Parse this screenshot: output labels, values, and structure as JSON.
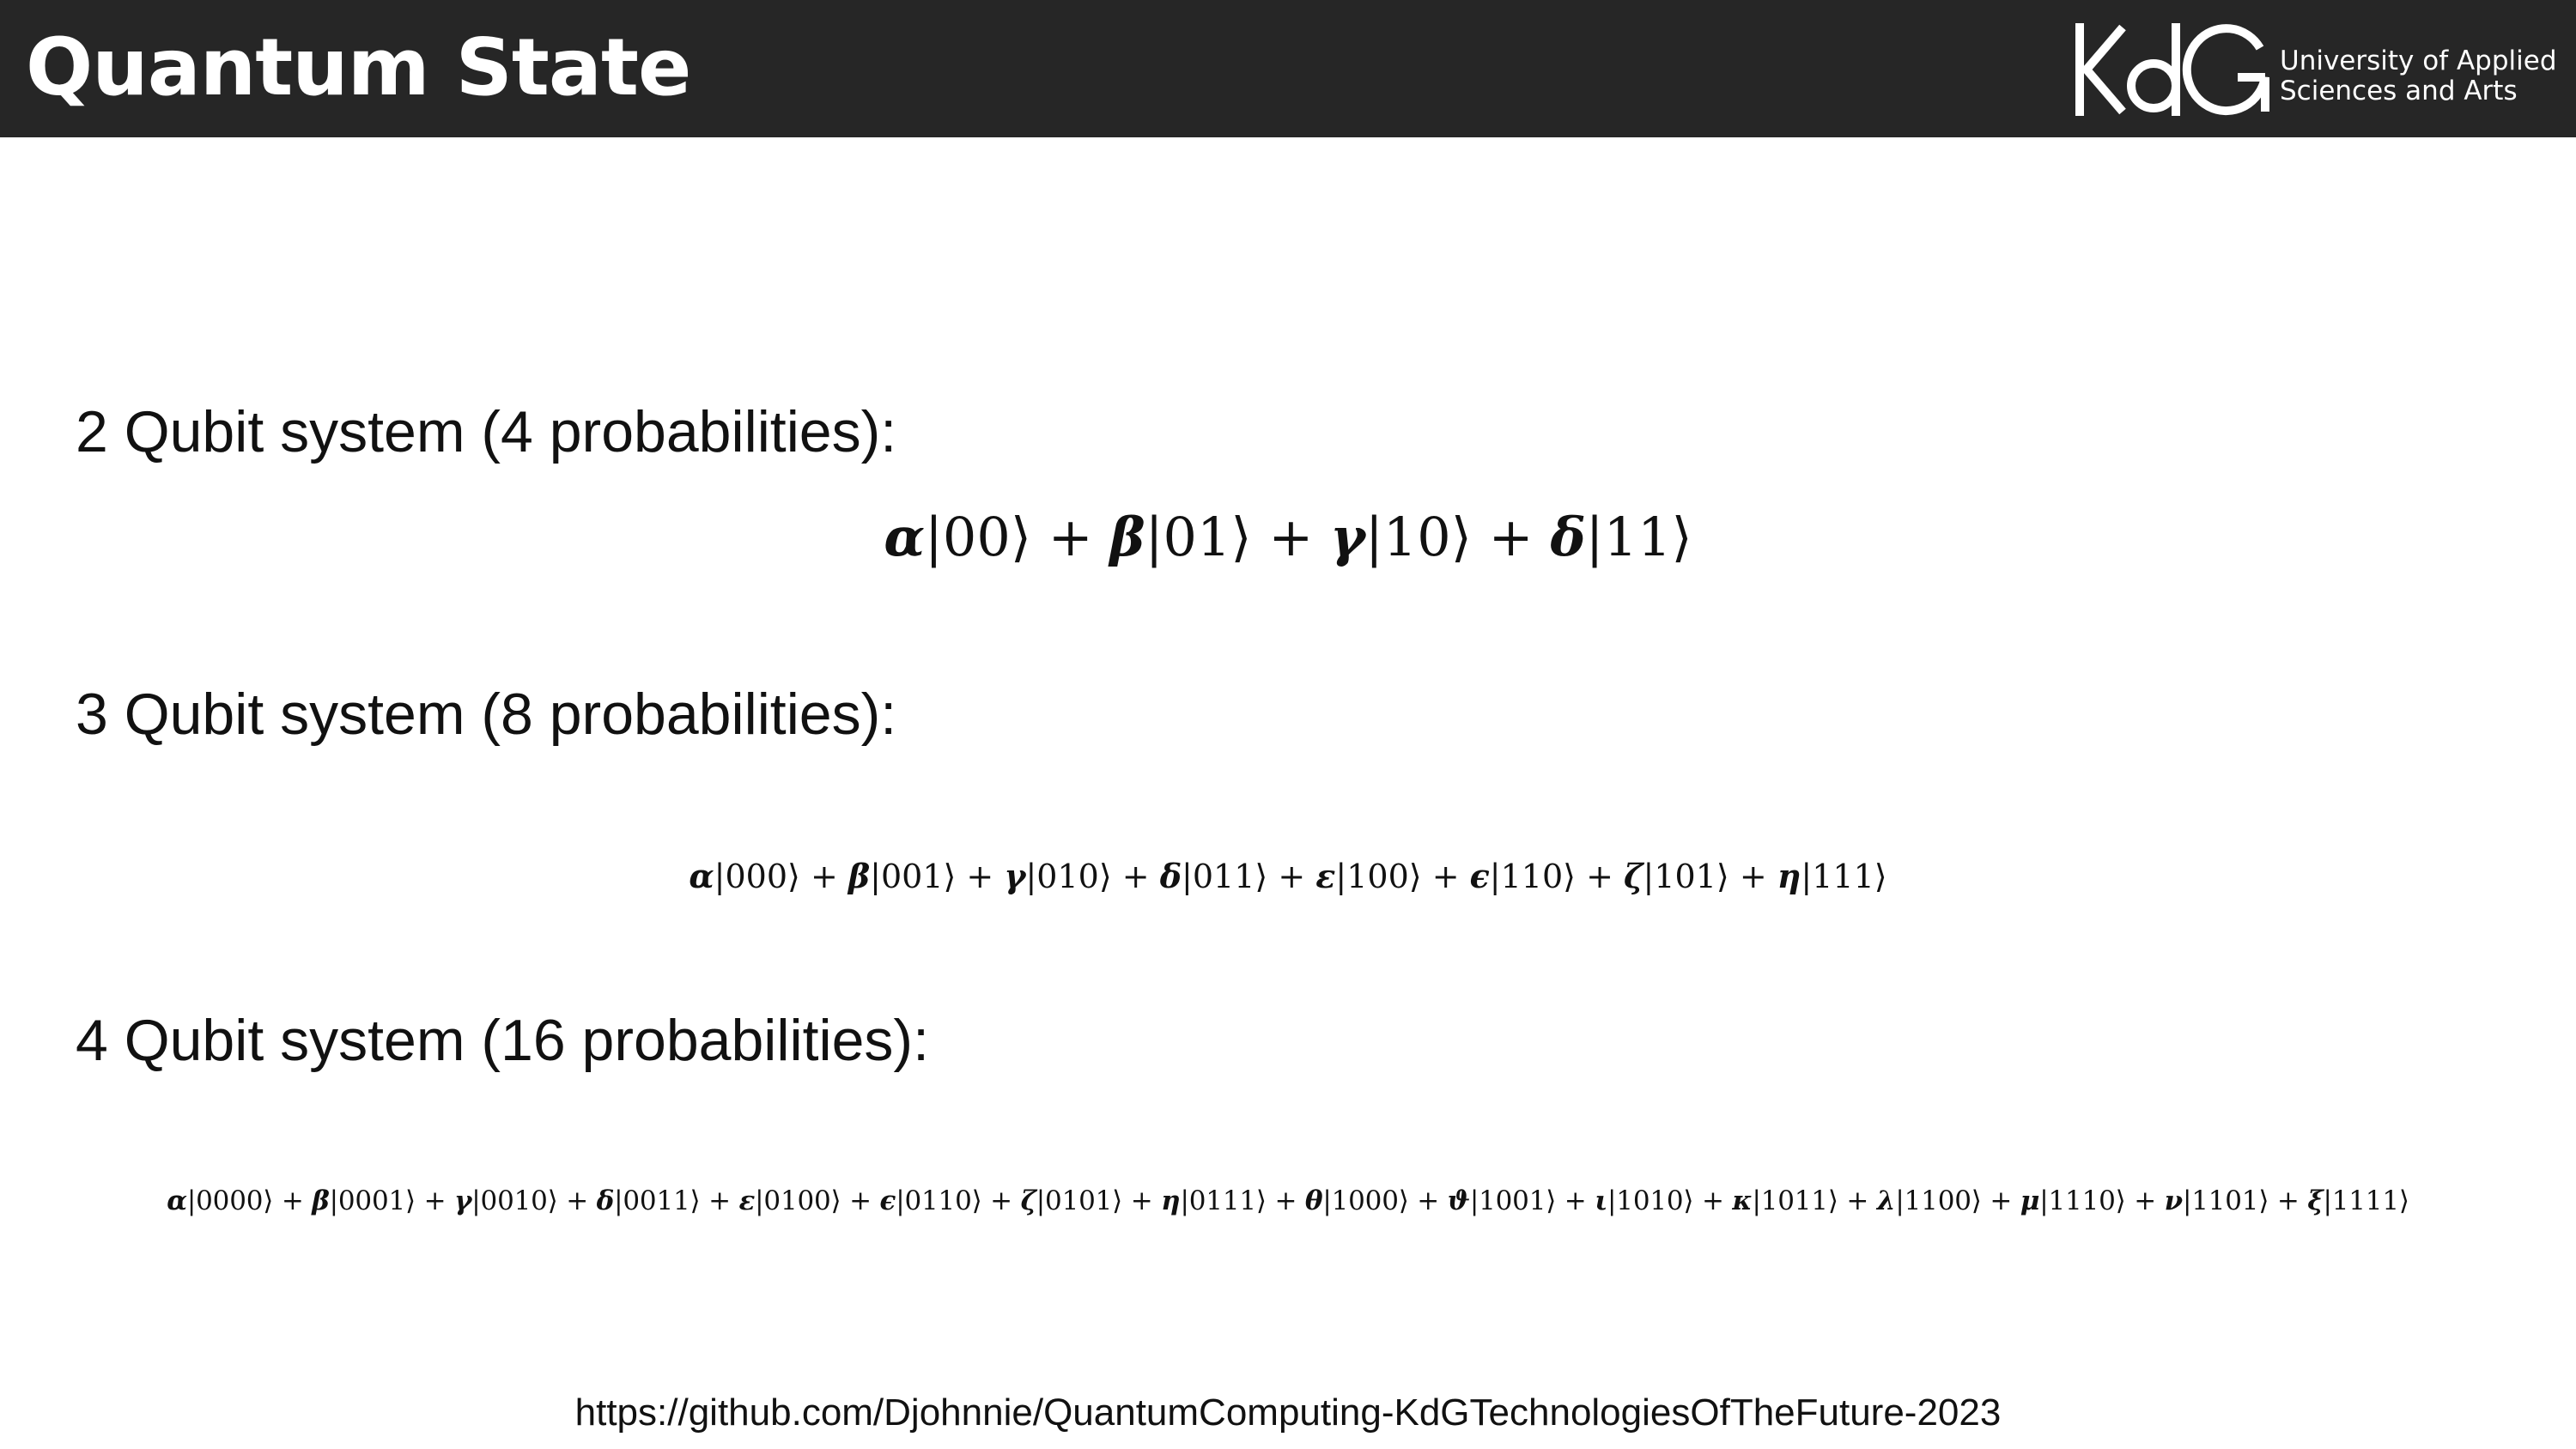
{
  "header": {
    "title": "Quantum State",
    "logo_mark": "KdG",
    "logo_line1": "University of Applied",
    "logo_line2": "Sciences and Arts"
  },
  "sections": [
    {
      "heading": "2 Qubit system (4 probabilities):",
      "equation": "α|00⟩ + β|01⟩ + γ|10⟩ + δ|11⟩"
    },
    {
      "heading": "3 Qubit system (8 probabilities):",
      "equation": "α|000⟩ + β|001⟩ + γ|010⟩ + δ|011⟩ + ε|100⟩ + ϵ|110⟩ + ζ|101⟩ + η|111⟩"
    },
    {
      "heading": "4 Qubit system (16 probabilities):",
      "equation": "α|0000⟩ + β|0001⟩ + γ|0010⟩ + δ|0011⟩ + ε|0100⟩ + ϵ|0110⟩ + ζ|0101⟩ + η|0111⟩ + θ|1000⟩ + ϑ|1001⟩ + ι|1010⟩ + κ|1011⟩ + λ|1100⟩ + μ|1110⟩ + ν|1101⟩ + ξ|1111⟩"
    }
  ],
  "footer": {
    "link_text": "https://github.com/Djohnnie/QuantumComputing-KdGTechnologiesOfTheFuture-2023"
  }
}
